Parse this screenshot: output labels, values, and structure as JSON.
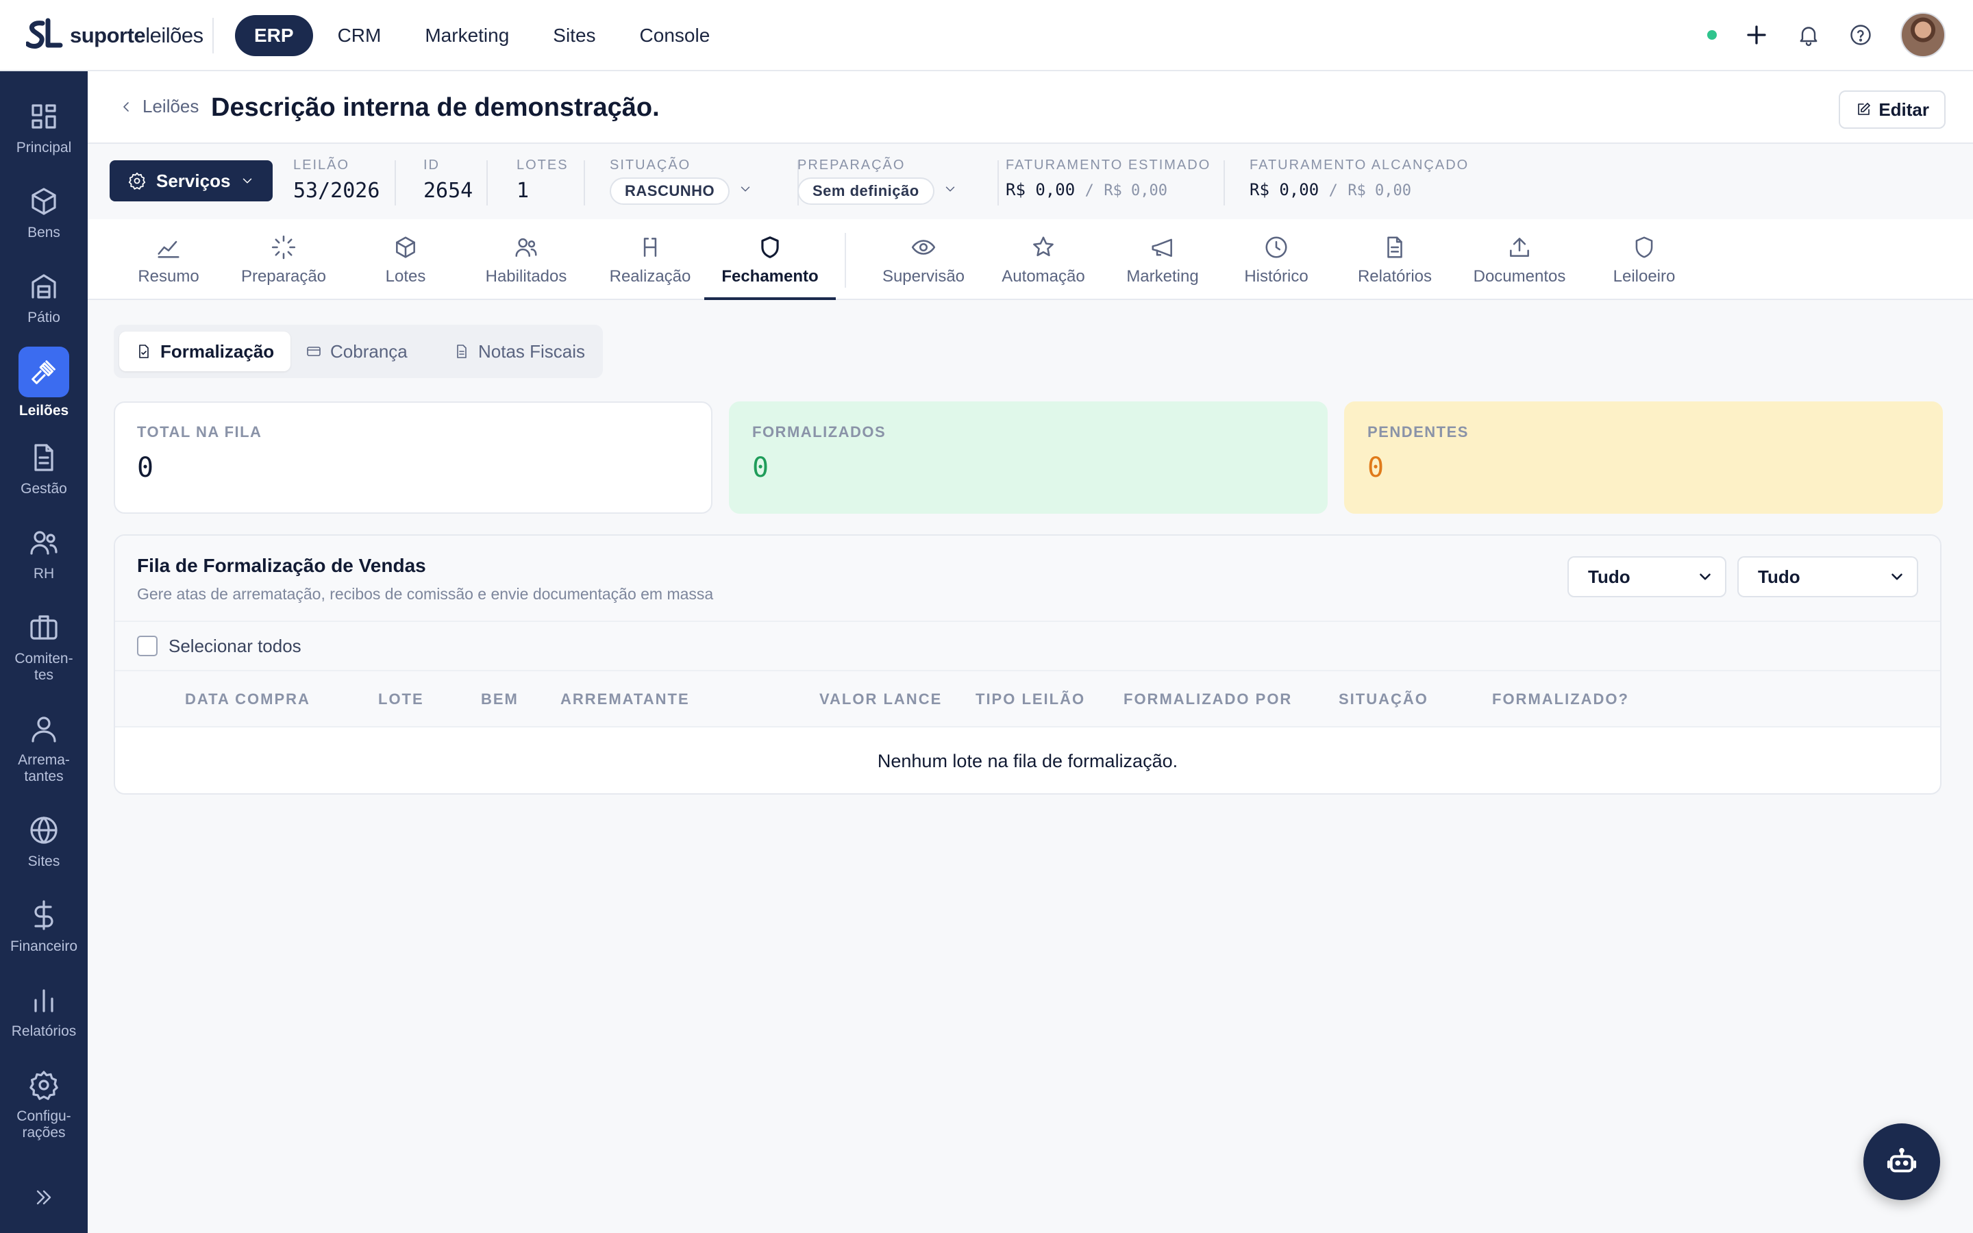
{
  "brand": {
    "name_bold": "suporte",
    "name_light": "leilões"
  },
  "topnav": [
    {
      "label": "ERP",
      "active": true
    },
    {
      "label": "CRM"
    },
    {
      "label": "Marketing"
    },
    {
      "label": "Sites"
    },
    {
      "label": "Console"
    }
  ],
  "topbar_icons": [
    "status-dot",
    "plus-icon",
    "bell-icon",
    "help-icon",
    "avatar"
  ],
  "sidebar": [
    {
      "label": "Principal",
      "icon": "grid-icon"
    },
    {
      "label": "Bens",
      "icon": "box-icon"
    },
    {
      "label": "Pátio",
      "icon": "warehouse-icon"
    },
    {
      "label": "Leilões",
      "icon": "gavel-icon",
      "active": true
    },
    {
      "label": "Gestão",
      "icon": "document-icon"
    },
    {
      "label": "RH",
      "icon": "users-icon"
    },
    {
      "label": "Comiten-tes",
      "l1": "Comiten-",
      "l2": "tes",
      "icon": "briefcase-icon"
    },
    {
      "label": "Arrema-tantes",
      "l1": "Arrema-",
      "l2": "tantes",
      "icon": "user-icon"
    },
    {
      "label": "Sites",
      "icon": "globe-icon"
    },
    {
      "label": "Financeiro",
      "icon": "dollar-icon"
    },
    {
      "label": "Relatórios",
      "icon": "bar-chart-icon"
    },
    {
      "label": "Configu-rações",
      "l1": "Configu-",
      "l2": "rações",
      "icon": "gear-icon"
    }
  ],
  "header": {
    "breadcrumb": "Leilões",
    "title": "Descrição interna de demonstração.",
    "edit_label": "Editar"
  },
  "info": {
    "service_label": "Serviços",
    "leilao_label": "LEILÃO",
    "leilao_value": "53/2026",
    "id_label": "ID",
    "id_value": "2654",
    "lotes_label": "LOTES",
    "lotes_value": "1",
    "situacao_label": "SITUAÇÃO",
    "situacao_value": "RASCUNHO",
    "preparacao_label": "PREPARAÇÃO",
    "preparacao_value": "Sem definição",
    "fat_est_label": "FATURAMENTO ESTIMADO",
    "fat_est_value": "R$ 0,00",
    "fat_est_total": "R$ 0,00",
    "fat_alc_label": "FATURAMENTO ALCANÇADO",
    "fat_alc_value": "R$ 0,00",
    "fat_alc_total": "R$ 0,00",
    "separator": "/"
  },
  "tabs": [
    {
      "label": "Resumo",
      "icon": "trend-icon"
    },
    {
      "label": "Preparação",
      "icon": "loader-icon"
    },
    {
      "label": "Lotes",
      "icon": "box-icon"
    },
    {
      "label": "Habilitados",
      "icon": "users-icon"
    },
    {
      "label": "Realização",
      "icon": "bracket-icon"
    },
    {
      "label": "Fechamento",
      "icon": "shield-icon",
      "active": true
    },
    {
      "label": "Supervisão",
      "icon": "eye-icon"
    },
    {
      "label": "Automação",
      "icon": "star-icon"
    },
    {
      "label": "Marketing",
      "icon": "megaphone-icon"
    },
    {
      "label": "Histórico",
      "icon": "clock-icon"
    },
    {
      "label": "Relatórios",
      "icon": "document-icon"
    },
    {
      "label": "Documentos",
      "icon": "upload-icon"
    },
    {
      "label": "Leiloeiro",
      "icon": "shield-icon"
    }
  ],
  "subtabs": [
    {
      "label": "Formalização",
      "icon": "file-check-icon",
      "active": true
    },
    {
      "label": "Cobrança",
      "icon": "credit-card-icon"
    },
    {
      "label": "Notas Fiscais",
      "icon": "file-icon"
    }
  ],
  "kpis": [
    {
      "label": "TOTAL NA FILA",
      "value": "0"
    },
    {
      "label": "FORMALIZADOS",
      "value": "0"
    },
    {
      "label": "PENDENTES",
      "value": "0"
    }
  ],
  "queue": {
    "title": "Fila de Formalização de Vendas",
    "subtitle": "Gere atas de arrematação, recibos de comissão e envie documentação em massa",
    "filter1": "Tudo",
    "filter2": "Tudo",
    "select_all": "Selecionar todos",
    "columns": [
      "DATA COMPRA",
      "LOTE",
      "BEM",
      "ARREMATANTE",
      "VALOR LANCE",
      "TIPO LEILÃO",
      "FORMALIZADO POR",
      "SITUAÇÃO",
      "FORMALIZADO?"
    ],
    "rows": [],
    "empty_text": "Nenhum lote na fila de formalização."
  },
  "colors": {
    "navy": "#1b2a4e",
    "accent": "#3b6cf0",
    "green": "#1f9d5a",
    "orange": "#e07a1a"
  }
}
